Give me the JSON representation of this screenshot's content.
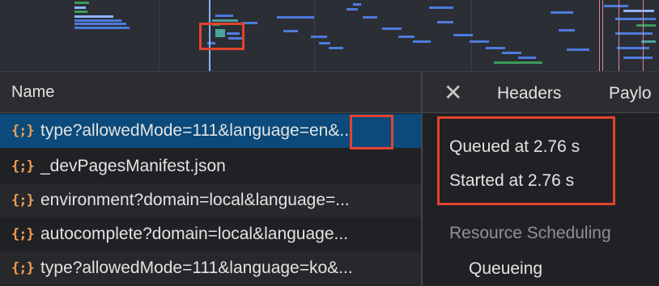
{
  "overview": {
    "name": "network-overview"
  },
  "requests": {
    "header": "Name",
    "rows": [
      {
        "icon": "{;}",
        "name": "type?allowedMode=111&language=en&..."
      },
      {
        "icon": "{;}",
        "name": "_devPagesManifest.json"
      },
      {
        "icon": "{;}",
        "name": "environment?domain=local&language=..."
      },
      {
        "icon": "{;}",
        "name": "autocomplete?domain=local&language..."
      },
      {
        "icon": "{;}",
        "name": "type?allowedMode=111&language=ko&..."
      }
    ]
  },
  "details": {
    "close_label": "✕",
    "tabs": [
      "Headers",
      "Paylo"
    ],
    "timing": {
      "queued": "Queued at 2.76 s",
      "started": "Started at 2.76 s"
    },
    "section_title": "Resource Scheduling",
    "section_item": "Queueing"
  },
  "colors": {
    "selected_row": "#0b4a7a",
    "highlight": "#e3432e",
    "request_icon": "#f29f52"
  }
}
